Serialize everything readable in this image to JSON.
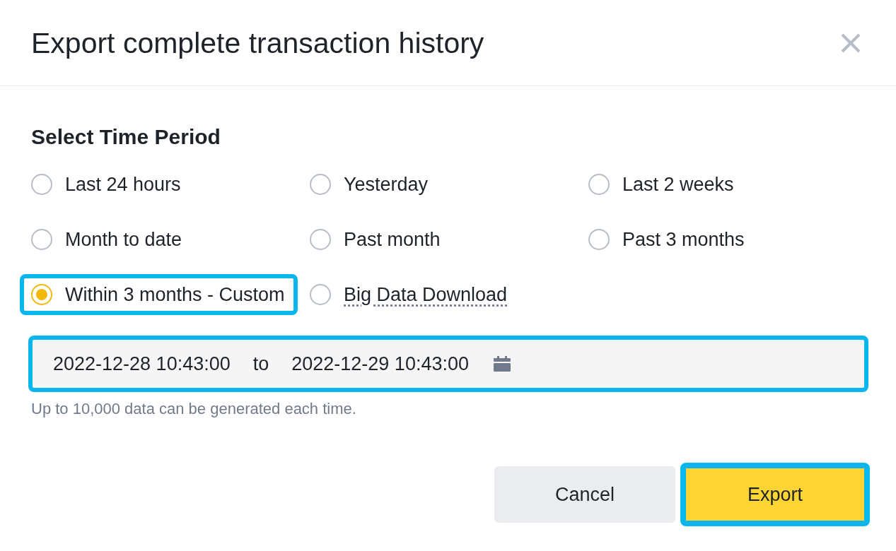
{
  "dialog": {
    "title": "Export complete transaction history",
    "section_title": "Select Time Period",
    "options": [
      {
        "label": "Last 24 hours",
        "kind": "plain",
        "selected": false,
        "highlighted": false
      },
      {
        "label": "Yesterday",
        "kind": "plain",
        "selected": false,
        "highlighted": false
      },
      {
        "label": "Last 2 weeks",
        "kind": "plain",
        "selected": false,
        "highlighted": false
      },
      {
        "label": "Month to date",
        "kind": "plain",
        "selected": false,
        "highlighted": false
      },
      {
        "label": "Past month",
        "kind": "plain",
        "selected": false,
        "highlighted": false
      },
      {
        "label": "Past 3 months",
        "kind": "plain",
        "selected": false,
        "highlighted": false
      },
      {
        "label": "Within 3 months - Custom",
        "kind": "plain",
        "selected": true,
        "highlighted": true
      },
      {
        "label": "Big Data Download",
        "kind": "link",
        "selected": false,
        "highlighted": false
      }
    ],
    "date_range": {
      "start": "2022-12-28 10:43:00",
      "separator": "to",
      "end": "2022-12-29 10:43:00",
      "highlighted": true
    },
    "hint": "Up to 10,000 data can be generated each time.",
    "buttons": [
      {
        "label": "Cancel",
        "kind": "secondary",
        "highlighted": false
      },
      {
        "label": "Export",
        "kind": "primary",
        "highlighted": true
      }
    ]
  }
}
